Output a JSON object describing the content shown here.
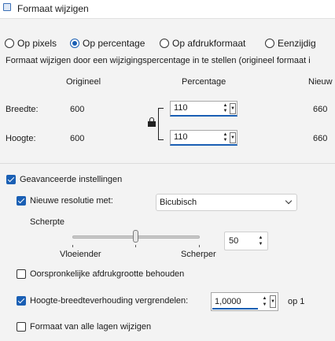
{
  "window": {
    "title": "Formaat wijzigen"
  },
  "mode_options": [
    {
      "label": "Op pixels",
      "selected": false
    },
    {
      "label": "Op percentage",
      "selected": true
    },
    {
      "label": "Op afdrukformaat",
      "selected": false
    },
    {
      "label": "Eenzijdig",
      "selected": false
    }
  ],
  "description": "Formaat wijzigen door een wijzigingspercentage in te stellen (origineel formaat  i",
  "columns": {
    "original": "Origineel",
    "percentage": "Percentage",
    "new": "Nieuw"
  },
  "rows": {
    "width": {
      "label": "Breedte:",
      "original": "600",
      "percentage": "110",
      "new": "660"
    },
    "height": {
      "label": "Hoogte:",
      "original": "600",
      "percentage": "110",
      "new": "660"
    }
  },
  "advanced": {
    "label": "Geavanceerde instellingen",
    "checked": true
  },
  "resolution": {
    "label": "Nieuwe resolutie met:",
    "checked": true,
    "method": "Bicubisch"
  },
  "sharpness": {
    "label": "Scherpte",
    "min_label": "Vloeiender",
    "max_label": "Scherper",
    "value": "50",
    "level": 0.5
  },
  "keep_print_size": {
    "label": "Oorspronkelijke afdrukgrootte behouden",
    "checked": false
  },
  "lock_ratio": {
    "label": "Hoogte-breedteverhouding vergrendelen:",
    "checked": true,
    "value": "1,0000",
    "suffix": "op 1"
  },
  "all_layers": {
    "label": "Formaat van alle lagen wijzigen",
    "checked": false
  },
  "colors": {
    "accent": "#1a5fb4",
    "background": "#f3f3f3"
  }
}
